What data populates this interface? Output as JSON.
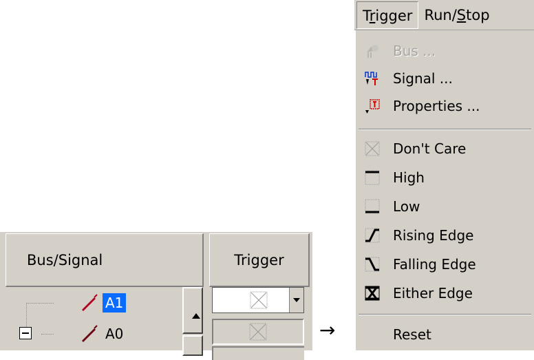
{
  "grid": {
    "header_bus": "Bus/Signal",
    "header_trigger": "Trigger",
    "signals": [
      {
        "label": "A1",
        "selected": true
      },
      {
        "label": "A0",
        "selected": false
      }
    ]
  },
  "transition_arrow": "→",
  "menubar": {
    "trigger_prefix": "T",
    "trigger_underlined": "r",
    "trigger_suffix": "igger",
    "runstop_prefix": "Run/",
    "runstop_underlined": "S",
    "runstop_suffix": "top"
  },
  "menu": {
    "items": [
      {
        "label": "Bus ...",
        "icon": "bus-icon",
        "disabled": true
      },
      {
        "label": "Signal ...",
        "icon": "signal-icon",
        "disabled": false
      },
      {
        "label": "Properties ...",
        "icon": "properties-icon",
        "disabled": false
      },
      {
        "label": "Don't Care",
        "icon": "dont-care-icon",
        "disabled": false
      },
      {
        "label": "High",
        "icon": "high-icon",
        "disabled": false
      },
      {
        "label": "Low",
        "icon": "low-icon",
        "disabled": false
      },
      {
        "label": "Rising Edge",
        "icon": "rising-edge-icon",
        "disabled": false
      },
      {
        "label": "Falling Edge",
        "icon": "falling-edge-icon",
        "disabled": false
      },
      {
        "label": "Either Edge",
        "icon": "either-edge-icon",
        "disabled": false
      },
      {
        "label": "Reset",
        "icon": "",
        "disabled": false
      }
    ]
  },
  "colors": {
    "face": "#d4d0c8",
    "selection": "#0a6cff",
    "probe": "#b00020"
  }
}
